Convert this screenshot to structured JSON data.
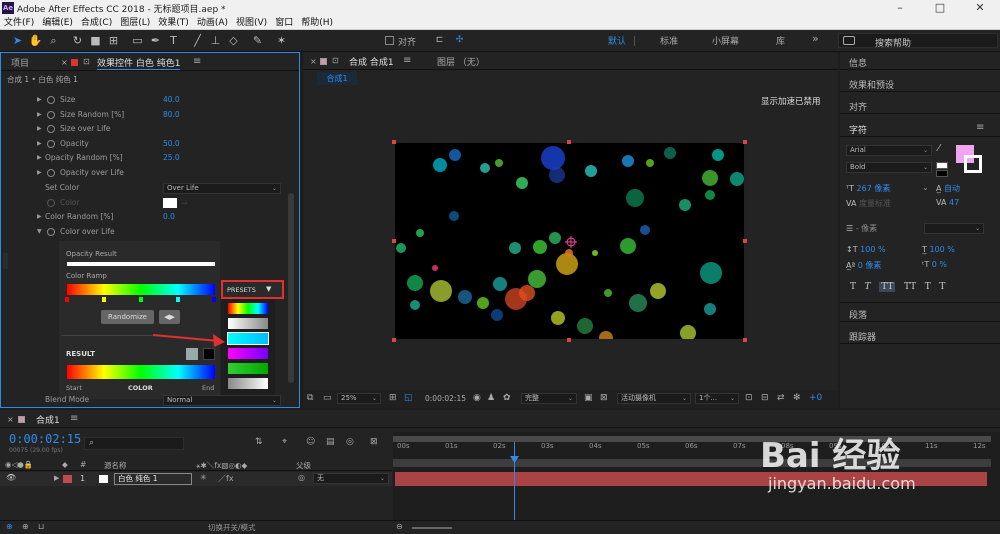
{
  "window": {
    "title": "Adobe After Effects CC 2018 - 无标题项目.aep *",
    "app_badge": "Ae"
  },
  "menu": [
    "文件(F)",
    "编辑(E)",
    "合成(C)",
    "图层(L)",
    "效果(T)",
    "动画(A)",
    "视图(V)",
    "窗口",
    "帮助(H)"
  ],
  "toolbar": {
    "snap_label": "对齐",
    "workspaces": [
      "默认",
      "标准",
      "小屏幕",
      "库"
    ],
    "more": "»",
    "search_placeholder": "搜索帮助"
  },
  "left_panel": {
    "tabs": [
      "项目",
      "效果控件 白色 纯色1"
    ],
    "breadcrumb": "合成 1 • 白色 纯色 1",
    "props": [
      {
        "name": "Size",
        "value": "40.0"
      },
      {
        "name": "Size Random [%]",
        "value": "80.0"
      },
      {
        "name": "Size over Life",
        "value": ""
      },
      {
        "name": "Opacity",
        "value": "50.0"
      },
      {
        "name": "Opacity Random [%]",
        "value": "25.0"
      },
      {
        "name": "Opacity over Life",
        "value": ""
      }
    ],
    "set_color": {
      "label": "Set Color",
      "value": "Over Life"
    },
    "color": {
      "label": "Color"
    },
    "color_random": {
      "label": "Color Random [%]",
      "value": "0.0"
    },
    "color_over_life": {
      "label": "Color over Life"
    },
    "opacity_result": "Opacity Result",
    "color_ramp": "Color Ramp",
    "presets": "PRESETS",
    "randomize": "Randomize",
    "result": "RESULT",
    "start": "Start",
    "color_word": "COLOR",
    "end": "End",
    "blend_mode": {
      "label": "Blend Mode",
      "value": "Normal"
    }
  },
  "comp_panel": {
    "tabs": [
      "合成 合成1",
      "图层 （无）"
    ],
    "subtab": "合成1",
    "notice": "显示加速已禁用",
    "controls": {
      "zoom": "25%",
      "timecode": "0:00:02:15",
      "resolution": "完整",
      "camera": "活动摄像机",
      "views": "1个..."
    }
  },
  "right_panel": {
    "items": [
      "信息",
      "效果和预设",
      "对齐"
    ],
    "character_title": "字符",
    "font": "Arial",
    "style": "Bold",
    "size": "267 像素",
    "leading": "自动",
    "kerning": "度量标准",
    "tracking": "47",
    "stroke": "- 像素",
    "vscale": "100 %",
    "hscale": "100 %",
    "baseline": "0 像素",
    "tsume": "0 %",
    "text_styles": [
      "T",
      "T",
      "TT",
      "TT",
      "T",
      "T"
    ],
    "paragraph": "段落",
    "tracker": "跟踪器"
  },
  "timeline": {
    "tab": "合成1",
    "timecode": "0:00:02:15",
    "frame_info": "00075 (29.00 fps)",
    "search_placeholder": "",
    "columns": {
      "source": "源名称",
      "parent": "父级"
    },
    "layer": {
      "number": "1",
      "name": "白色 纯色 1",
      "parent": "无"
    },
    "ruler": [
      "00s",
      "01s",
      "02s",
      "03s",
      "04s",
      "05s",
      "06s",
      "07s",
      "08s",
      "09s",
      "10s",
      "11s",
      "12s"
    ],
    "toggle_label": "切换开关/模式"
  },
  "watermark": {
    "text": "Bai 经验",
    "url": "jingyan.baidu.com"
  },
  "colors": {
    "accent": "#2d8ceb",
    "highlight": "#e03030",
    "layer_bar": "#c34a4a",
    "swatch": "#f1a5f1"
  }
}
